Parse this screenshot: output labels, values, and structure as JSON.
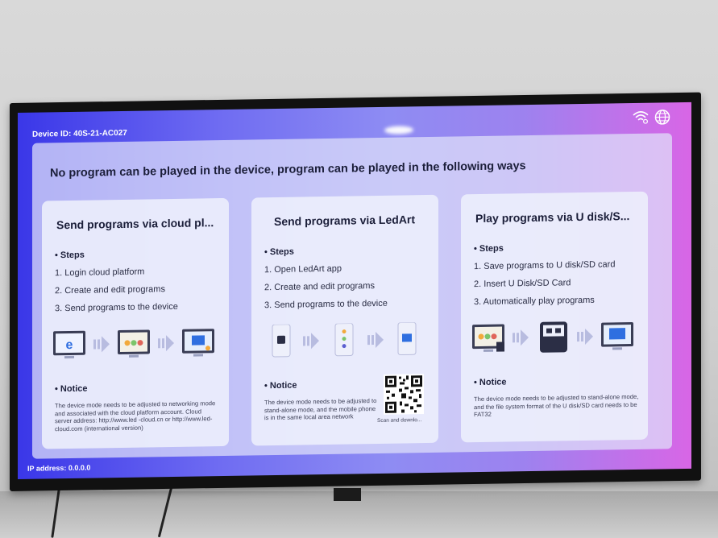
{
  "screen": {
    "device_id": "Device ID: 40S-21-AC027",
    "ip_address": "IP address: 0.0.0.0",
    "headline": "No program can be played in the device, program can be played in the following ways"
  },
  "cards": [
    {
      "title": "Send programs via cloud pl...",
      "steps_heading": "• Steps",
      "steps": [
        "1. Login cloud platform",
        "2. Create and edit programs",
        "3. Send programs to the device"
      ],
      "notice_heading": "• Notice",
      "notice": "The device mode needs to be adjusted to networking mode and associated with the cloud platform account. Cloud server address: http://www.led -cloud.cn or http://www.led-cloud.com (international version)"
    },
    {
      "title": "Send programs via LedArt",
      "steps_heading": "• Steps",
      "steps": [
        "1. Open LedArt app",
        "2. Create and edit programs",
        "3. Send programs to the device"
      ],
      "notice_heading": "• Notice",
      "notice": "The device mode needs to be adjusted to stand-alone mode, and the mobile phone is in the same local area network",
      "qr_caption": "Scan and downlo..."
    },
    {
      "title": "Play programs via U disk/S...",
      "steps_heading": "• Steps",
      "steps": [
        "1. Save programs to U disk/SD card",
        "2. Insert U Disk/SD Card",
        "3. Automatically play programs"
      ],
      "notice_heading": "• Notice",
      "notice": "The device mode needs to be adjusted to stand-alone mode, and the file system format of the U disk/SD card needs to be FAT32"
    }
  ],
  "icons": {
    "status": [
      "wifi-icon",
      "globe-icon"
    ],
    "cloud_flow": [
      "browser-monitor-icon",
      "editor-monitor-icon",
      "send-monitor-icon"
    ],
    "ledart_flow": [
      "phone-app-icon",
      "phone-edit-icon",
      "phone-send-icon"
    ],
    "udisk_flow": [
      "monitor-sdcard-icon",
      "udisk-icon",
      "device-play-icon"
    ]
  },
  "colors": {
    "screen_left": "#3a37e8",
    "screen_right": "#d866e6",
    "accent_blue": "#2f6fe0",
    "accent_orange": "#f2a93b"
  }
}
